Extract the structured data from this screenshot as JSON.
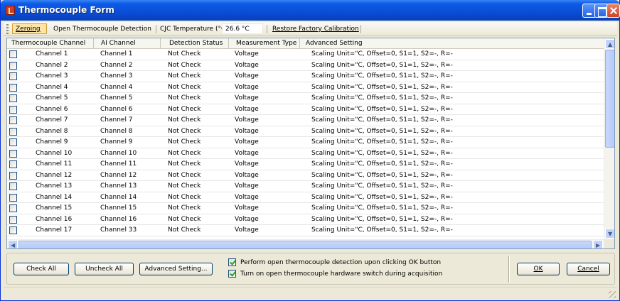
{
  "window": {
    "title": "Thermocouple Form"
  },
  "toolbar": {
    "zeroing": "Zeroing",
    "open_detection": "Open Thermocouple Detection",
    "cjc_label": "CJC Temperature (°C):",
    "cjc_value": "26.6 °C",
    "restore": "Restore Factory Calibration"
  },
  "table": {
    "columns": [
      "Thermocouple Channel",
      "AI Channel",
      "Detection Status",
      "Measurement Type",
      "Advanced Setting"
    ],
    "rows": [
      {
        "tc": "Channel 1",
        "ai": "Channel 1",
        "status": "Not Check",
        "type": "Voltage",
        "adv": "Scaling Unit=\"C, Offset=0, S1=1, S2=-, R=-"
      },
      {
        "tc": "Channel 2",
        "ai": "Channel 2",
        "status": "Not Check",
        "type": "Voltage",
        "adv": "Scaling Unit=\"C, Offset=0, S1=1, S2=-, R=-"
      },
      {
        "tc": "Channel 3",
        "ai": "Channel 3",
        "status": "Not Check",
        "type": "Voltage",
        "adv": "Scaling Unit=\"C, Offset=0, S1=1, S2=-, R=-"
      },
      {
        "tc": "Channel 4",
        "ai": "Channel 4",
        "status": "Not Check",
        "type": "Voltage",
        "adv": "Scaling Unit=\"C, Offset=0, S1=1, S2=-, R=-"
      },
      {
        "tc": "Channel 5",
        "ai": "Channel 5",
        "status": "Not Check",
        "type": "Voltage",
        "adv": "Scaling Unit=\"C, Offset=0, S1=1, S2=-, R=-"
      },
      {
        "tc": "Channel 6",
        "ai": "Channel 6",
        "status": "Not Check",
        "type": "Voltage",
        "adv": "Scaling Unit=\"C, Offset=0, S1=1, S2=-, R=-"
      },
      {
        "tc": "Channel 7",
        "ai": "Channel 7",
        "status": "Not Check",
        "type": "Voltage",
        "adv": "Scaling Unit=\"C, Offset=0, S1=1, S2=-, R=-"
      },
      {
        "tc": "Channel 8",
        "ai": "Channel 8",
        "status": "Not Check",
        "type": "Voltage",
        "adv": "Scaling Unit=\"C, Offset=0, S1=1, S2=-, R=-"
      },
      {
        "tc": "Channel 9",
        "ai": "Channel 9",
        "status": "Not Check",
        "type": "Voltage",
        "adv": "Scaling Unit=\"C, Offset=0, S1=1, S2=-, R=-"
      },
      {
        "tc": "Channel 10",
        "ai": "Channel 10",
        "status": "Not Check",
        "type": "Voltage",
        "adv": "Scaling Unit=\"C, Offset=0, S1=1, S2=-, R=-"
      },
      {
        "tc": "Channel 11",
        "ai": "Channel 11",
        "status": "Not Check",
        "type": "Voltage",
        "adv": "Scaling Unit=\"C, Offset=0, S1=1, S2=-, R=-"
      },
      {
        "tc": "Channel 12",
        "ai": "Channel 12",
        "status": "Not Check",
        "type": "Voltage",
        "adv": "Scaling Unit=\"C, Offset=0, S1=1, S2=-, R=-"
      },
      {
        "tc": "Channel 13",
        "ai": "Channel 13",
        "status": "Not Check",
        "type": "Voltage",
        "adv": "Scaling Unit=\"C, Offset=0, S1=1, S2=-, R=-"
      },
      {
        "tc": "Channel 14",
        "ai": "Channel 14",
        "status": "Not Check",
        "type": "Voltage",
        "adv": "Scaling Unit=\"C, Offset=0, S1=1, S2=-, R=-"
      },
      {
        "tc": "Channel 15",
        "ai": "Channel 15",
        "status": "Not Check",
        "type": "Voltage",
        "adv": "Scaling Unit=\"C, Offset=0, S1=1, S2=-, R=-"
      },
      {
        "tc": "Channel 16",
        "ai": "Channel 16",
        "status": "Not Check",
        "type": "Voltage",
        "adv": "Scaling Unit=\"C, Offset=0, S1=1, S2=-, R=-"
      },
      {
        "tc": "Channel 17",
        "ai": "Channel 33",
        "status": "Not Check",
        "type": "Voltage",
        "adv": "Scaling Unit=\"C, Offset=0, S1=1, S2=-, R=-"
      }
    ]
  },
  "buttons": {
    "check_all": "Check All",
    "uncheck_all": "Uncheck All",
    "advanced_setting": "Advanced Setting...",
    "ok": "OK",
    "cancel": "Cancel"
  },
  "options": {
    "open_detection_on_ok": "Perform open thermocouple detection upon clicking OK button",
    "open_detection_on_ok_checked": true,
    "hardware_switch": "Turn on open thermocouple hardware switch during acquisition",
    "hardware_switch_checked": true
  }
}
